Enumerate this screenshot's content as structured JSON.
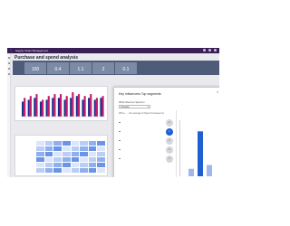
{
  "app": {
    "title": "Supply Chain Management",
    "launcher_icon": "app-launcher-icon"
  },
  "report": {
    "title": "Purchase and spend analysis"
  },
  "kpi_cards": [
    {
      "label": "",
      "value": "100"
    },
    {
      "label": "",
      "value": "0.4"
    },
    {
      "label": "",
      "value": "1.1"
    },
    {
      "label": "",
      "value": "2"
    },
    {
      "label": "",
      "value": "0.1"
    }
  ],
  "colors": {
    "title_bar": "#3a1f56",
    "band": "#4e5c79",
    "card": "#7b8aa5",
    "bar_navy": "#1c2f8c",
    "bar_magenta": "#c21a6b",
    "bar_blue": "#2f6fe0",
    "highlight": "#1f5fd0"
  },
  "chart_data": {
    "type": "bar",
    "categories": [
      "1",
      "2",
      "3",
      "4",
      "5",
      "6",
      "7",
      "8",
      "9",
      "10",
      "11",
      "12",
      "13",
      "14"
    ],
    "series": [
      {
        "values": [
          8,
          9,
          10,
          8,
          9,
          10,
          10,
          9,
          10,
          11,
          9,
          10,
          9,
          10
        ]
      },
      {
        "values": [
          10,
          11,
          12,
          9,
          11,
          12,
          12,
          11,
          13,
          12,
          11,
          12,
          10,
          11
        ]
      }
    ],
    "ylim": [
      0,
      14
    ],
    "grid": false
  },
  "table": {
    "rows": [
      {
        "label": "",
        "cells": 8
      },
      {
        "label": "",
        "cells": 8
      },
      {
        "label": "",
        "cells": 8
      },
      {
        "label": "",
        "cells": 8
      },
      {
        "label": "",
        "cells": 8
      },
      {
        "label": "",
        "cells": 8
      }
    ]
  },
  "key_influencers": {
    "title": "Key influencers   Top segments",
    "close_icon": "close-icon",
    "question": "What influences Spend to",
    "dropdown_value": "Increase",
    "factor_head": "When...   ...the average of Spend increases by",
    "factors": [
      {
        "text": "",
        "value": "1"
      },
      {
        "text": "",
        "value": "1"
      },
      {
        "text": "",
        "value": "1"
      },
      {
        "text": "",
        "value": "1"
      },
      {
        "text": "",
        "value": "1"
      }
    ],
    "side_title": "",
    "side_chart": {
      "values": [
        2,
        12,
        3
      ]
    }
  }
}
